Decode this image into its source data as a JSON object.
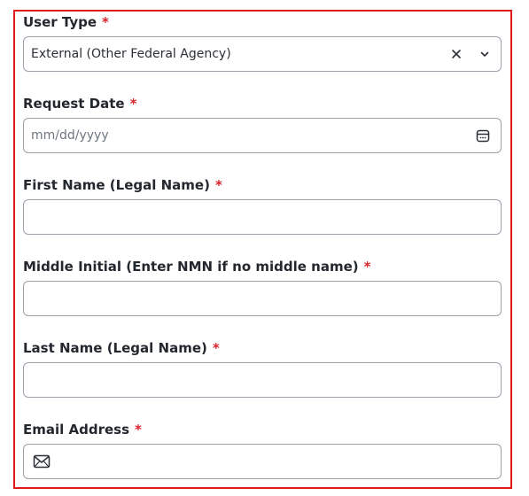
{
  "form": {
    "user_type": {
      "label": "User Type",
      "required_mark": "*",
      "value": "External (Other Federal Agency)"
    },
    "request_date": {
      "label": "Request Date",
      "required_mark": "*",
      "placeholder": "mm/dd/yyyy"
    },
    "first_name": {
      "label": "First Name (Legal Name)",
      "required_mark": "*",
      "value": ""
    },
    "middle_initial": {
      "label": "Middle Initial (Enter NMN if no middle name)",
      "required_mark": "*",
      "value": ""
    },
    "last_name": {
      "label": "Last Name (Legal Name)",
      "required_mark": "*",
      "value": ""
    },
    "email": {
      "label": "Email Address",
      "required_mark": "*",
      "value": ""
    }
  },
  "icons": {
    "clear": "close-icon",
    "dropdown": "chevron-down-icon",
    "calendar": "calendar-icon",
    "email": "envelope-icon"
  },
  "colors": {
    "highlight_border": "#e0191b",
    "required_asterisk": "#d5232a",
    "label_text": "#23272e",
    "input_border": "#9aa1a9"
  }
}
